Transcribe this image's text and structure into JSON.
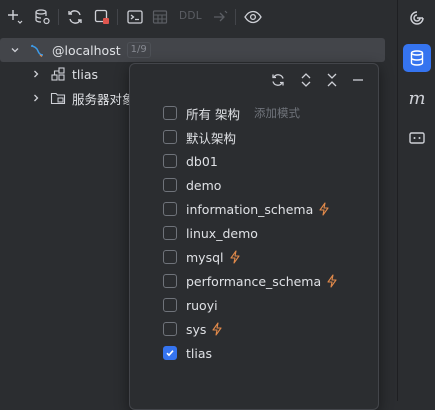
{
  "toolbar": {
    "buttons": [
      {
        "name": "add-icon"
      },
      {
        "name": "data-source-properties-icon"
      },
      {
        "name": "refresh-icon"
      },
      {
        "name": "stop-icon"
      },
      {
        "name": "console-icon"
      },
      {
        "name": "table-icon"
      },
      {
        "name": "jump-to-icon"
      },
      {
        "name": "view-options-icon"
      }
    ],
    "ddl_label": "DDL"
  },
  "tree": {
    "connection": {
      "label": "@localhost",
      "count": "1/9"
    },
    "children": [
      {
        "label": "tlias",
        "icon": "schema-icon"
      },
      {
        "label": "服务器对象",
        "icon": "folder-icon"
      }
    ]
  },
  "popup": {
    "select_all_label": "所有 架构",
    "add_pattern_hint": "添加模式",
    "schemas": [
      {
        "label": "默认架构",
        "checked": false,
        "bolt": false
      },
      {
        "label": "db01",
        "checked": false,
        "bolt": false
      },
      {
        "label": "demo",
        "checked": false,
        "bolt": false
      },
      {
        "label": "information_schema",
        "checked": false,
        "bolt": true
      },
      {
        "label": "linux_demo",
        "checked": false,
        "bolt": false
      },
      {
        "label": "mysql",
        "checked": false,
        "bolt": true
      },
      {
        "label": "performance_schema",
        "checked": false,
        "bolt": true
      },
      {
        "label": "ruoyi",
        "checked": false,
        "bolt": false
      },
      {
        "label": "sys",
        "checked": false,
        "bolt": true
      },
      {
        "label": "tlias",
        "checked": true,
        "bolt": false
      }
    ]
  },
  "right_bar": {
    "items": [
      {
        "name": "ai-assistant-icon",
        "active": false
      },
      {
        "name": "database-icon",
        "active": true
      },
      {
        "name": "maven-icon",
        "active": false
      },
      {
        "name": "endpoints-icon",
        "active": false
      }
    ],
    "maven_glyph": "m"
  },
  "colors": {
    "accent": "#3574f0",
    "bolt": "#e0894a",
    "background": "#2b2d30"
  }
}
